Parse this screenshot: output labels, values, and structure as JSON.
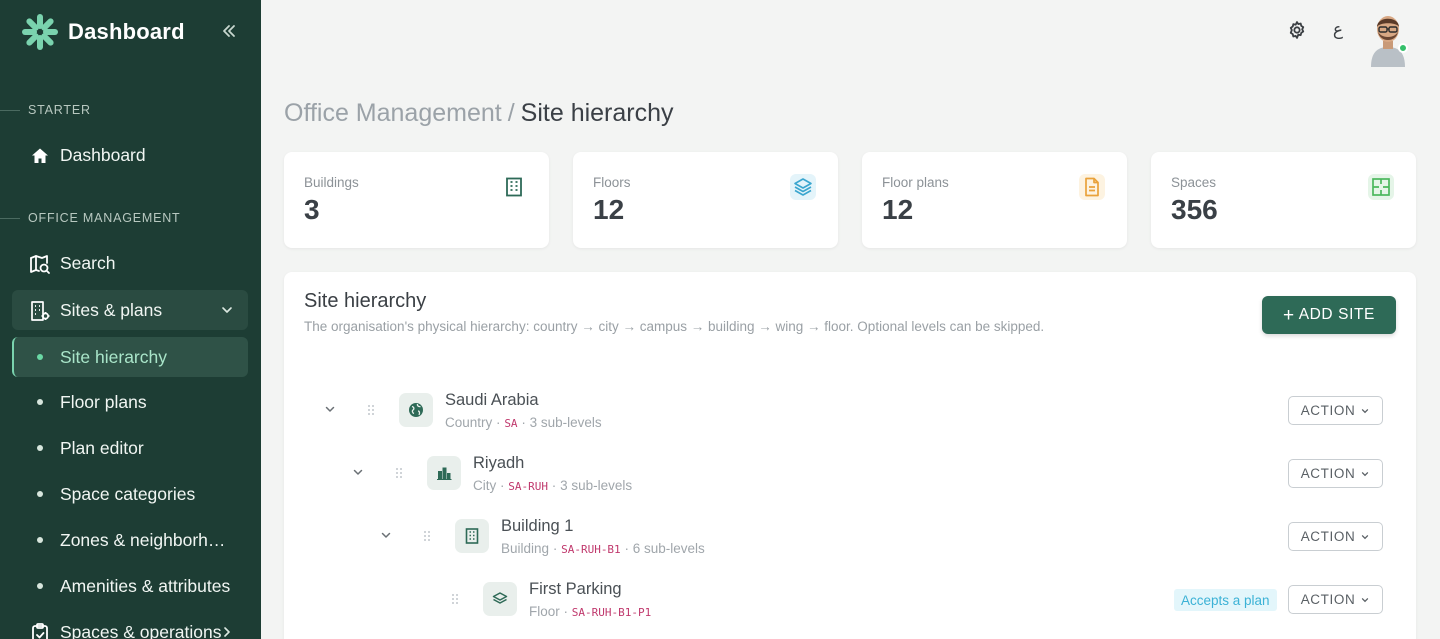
{
  "sidebar": {
    "brand": "Dashboard",
    "sections": [
      {
        "title": "STARTER"
      },
      {
        "title": "OFFICE MANAGEMENT"
      }
    ],
    "items": [
      {
        "label": "Dashboard",
        "icon": "home-icon"
      },
      {
        "label": "Search",
        "icon": "map-search-icon"
      },
      {
        "label": "Sites & plans",
        "icon": "building-cog-icon"
      },
      {
        "label": "Site hierarchy"
      },
      {
        "label": "Floor plans"
      },
      {
        "label": "Plan editor"
      },
      {
        "label": "Space categories"
      },
      {
        "label": "Zones & neighborhoods"
      },
      {
        "label": "Amenities & attributes"
      },
      {
        "label": "Spaces & operations",
        "icon": "clipboard-check-icon"
      }
    ]
  },
  "topbar": {
    "language_label": "ع",
    "icons": [
      "gear-icon",
      "language-icon",
      "avatar"
    ]
  },
  "breadcrumb": {
    "parent": "Office Management",
    "separator": "/",
    "current": "Site hierarchy"
  },
  "stats": [
    {
      "label": "Buildings",
      "value": "3",
      "icon": "building-icon",
      "color": "#2e6a57"
    },
    {
      "label": "Floors",
      "value": "12",
      "icon": "layers-icon",
      "color": "#3aa6cf"
    },
    {
      "label": "Floor plans",
      "value": "12",
      "icon": "document-icon",
      "color": "#e9a23b"
    },
    {
      "label": "Spaces",
      "value": "356",
      "icon": "floorplan-icon",
      "color": "#4bb85d"
    }
  ],
  "panel": {
    "title": "Site hierarchy",
    "subtitle": "The organisation's physical hierarchy: country → city → campus → building → wing → floor. Optional levels can be skipped.",
    "add_label": "ADD SITE",
    "add_plus": "+"
  },
  "tree": [
    {
      "name": "Saudi Arabia",
      "type": "Country",
      "code": "SA",
      "sub": "3 sub-levels",
      "icon": "globe-icon",
      "action": "ACTION"
    },
    {
      "name": "Riyadh",
      "type": "City",
      "code": "SA-RUH",
      "sub": "3 sub-levels",
      "icon": "city-icon",
      "action": "ACTION"
    },
    {
      "name": "Building 1",
      "type": "Building",
      "code": "SA-RUH-B1",
      "sub": "6 sub-levels",
      "icon": "building-icon",
      "action": "ACTION"
    },
    {
      "name": "First Parking",
      "type": "Floor",
      "code": "SA-RUH-B1-P1",
      "badge": "Accepts a plan",
      "icon": "layers-icon",
      "action": "ACTION"
    }
  ],
  "meta_separator": "·",
  "colors": {
    "sidebar_bg": "#1d3d34",
    "primary": "#2e6a57",
    "active_accent": "#6ad8a5",
    "code": "#c0396d"
  }
}
